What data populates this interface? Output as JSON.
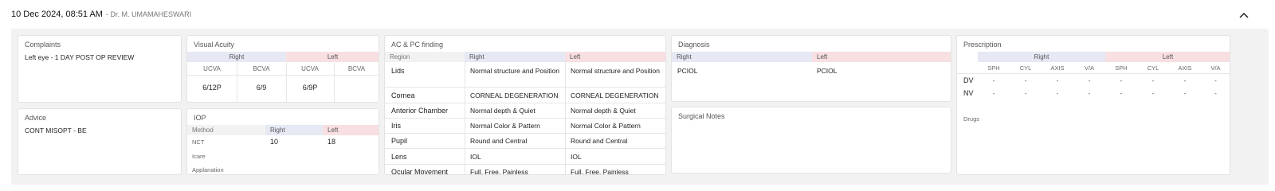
{
  "header": {
    "date": "10 Dec 2024, 08:51 AM",
    "doctor": "- Dr. M. UMAMAHESWARI",
    "collapse_icon": "chevron-up-icon"
  },
  "complaints": {
    "title": "Complaints",
    "text": "Left eye - 1 DAY POST OP REVIEW"
  },
  "advice": {
    "title": "Advice",
    "text": "CONT MISOPT - BE"
  },
  "visual_acuity": {
    "title": "Visual Acuity",
    "right_label": "Right",
    "left_label": "Left",
    "columns": [
      "UCVA",
      "BCVA",
      "UCVA",
      "BCVA"
    ],
    "values": [
      "6/12P",
      "6/9",
      "6/9P",
      ""
    ]
  },
  "iop": {
    "title": "IOP",
    "method_label": "Method",
    "right_label": "Right",
    "left_label": "Left",
    "rows": [
      {
        "method": "NCT",
        "right": "10",
        "left": "18"
      },
      {
        "method": "Icare",
        "right": "",
        "left": ""
      },
      {
        "method": "Applanation",
        "right": "",
        "left": ""
      }
    ]
  },
  "acpc": {
    "title": "AC & PC finding",
    "region_label": "Region",
    "right_label": "Right",
    "left_label": "Left",
    "rows": [
      {
        "region": "Lids",
        "right": "Normal structure and Position",
        "left": "Normal structure and Position"
      },
      {
        "region": "Cornea",
        "right": "CORNEAL DEGENERATION",
        "left": "CORNEAL DEGENERATION"
      },
      {
        "region": "Anterior Chamber",
        "right": "Normal depth & Quiet",
        "left": "Normal depth & Quiet"
      },
      {
        "region": "Iris",
        "right": "Normal Color & Pattern",
        "left": "Normal Color & Pattern"
      },
      {
        "region": "Pupil",
        "right": "Round and Central",
        "left": "Round and Central"
      },
      {
        "region": "Lens",
        "right": "IOL",
        "left": "IOL"
      },
      {
        "region": "Ocular Movement",
        "right": "Full, Free, Painless",
        "left": "Full, Free, Painless"
      }
    ]
  },
  "diagnosis": {
    "title": "Diagnosis",
    "right_label": "Right",
    "left_label": "Left",
    "right": "PCIOL",
    "left": "PCIOL"
  },
  "surgical_notes": {
    "title": "Surgical Notes"
  },
  "prescription": {
    "title": "Prescription",
    "right_label": "Right",
    "left_label": "Left",
    "columns": [
      "SPH",
      "CYL",
      "AXIS",
      "V/A",
      "SPH",
      "CYL",
      "AXIS",
      "V/A"
    ],
    "rows": [
      {
        "label": "DV",
        "values": [
          "-",
          "-",
          "-",
          "-",
          "-",
          "-",
          "-",
          "-"
        ]
      },
      {
        "label": "NV",
        "values": [
          "-",
          "-",
          "-",
          "-",
          "-",
          "-",
          "-",
          "-"
        ]
      }
    ],
    "drugs_label": "Drugs"
  }
}
